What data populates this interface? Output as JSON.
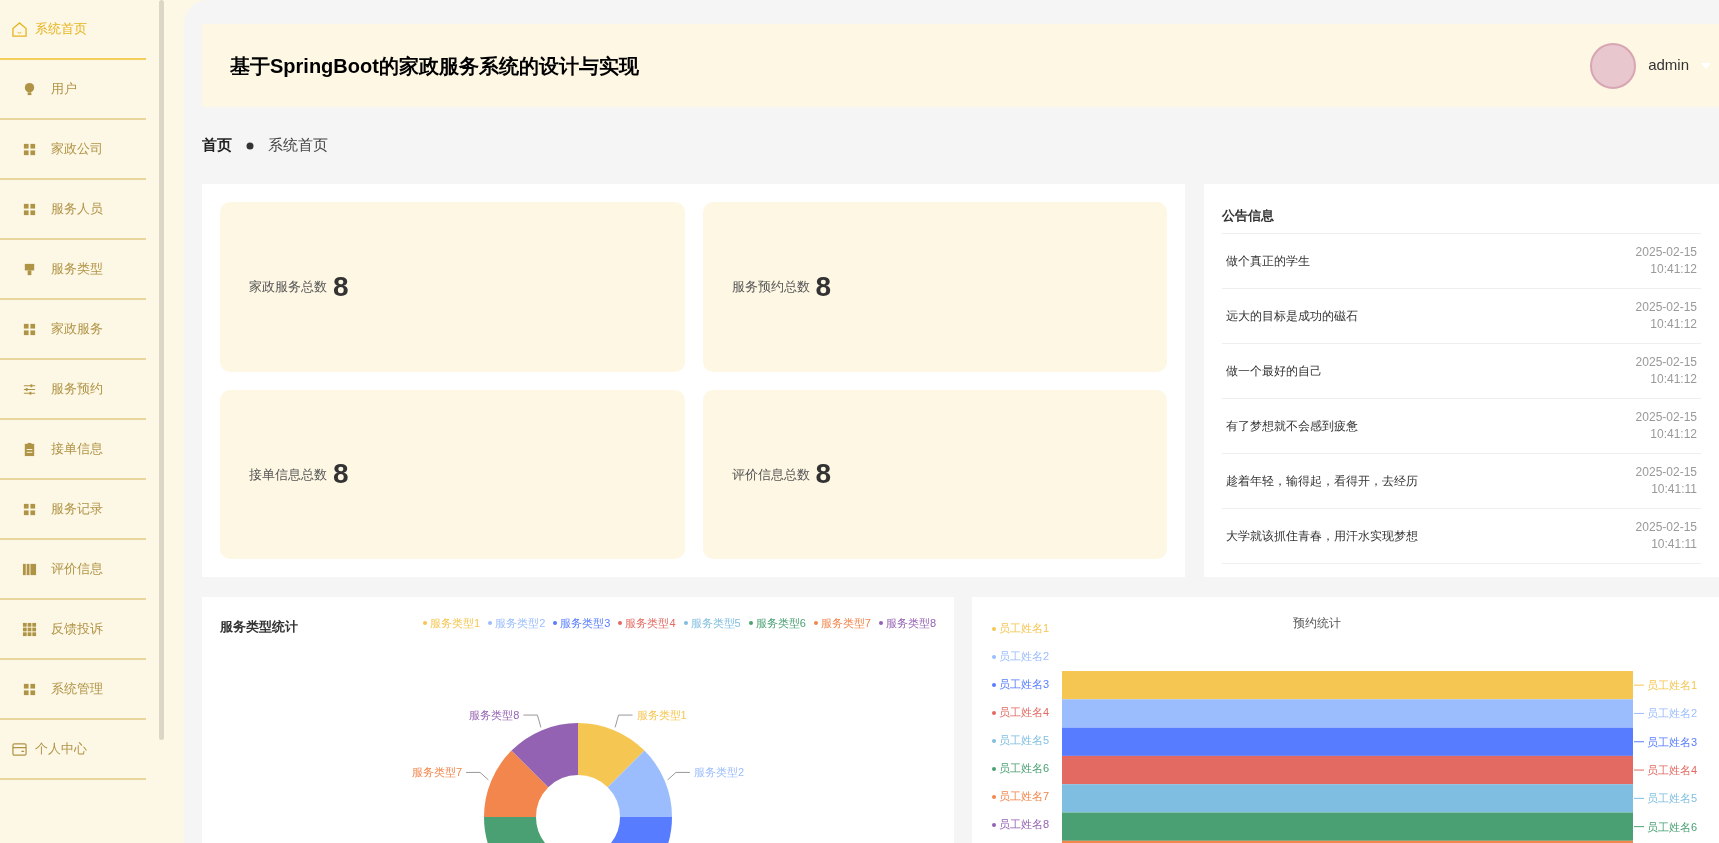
{
  "sidebar": {
    "items": [
      {
        "label": "系统首页",
        "selected": true,
        "kind": "home"
      },
      {
        "label": "用户",
        "selected": false,
        "kind": "menu"
      },
      {
        "label": "家政公司",
        "selected": false,
        "kind": "menu"
      },
      {
        "label": "服务人员",
        "selected": false,
        "kind": "menu"
      },
      {
        "label": "服务类型",
        "selected": false,
        "kind": "menu"
      },
      {
        "label": "家政服务",
        "selected": false,
        "kind": "menu"
      },
      {
        "label": "服务预约",
        "selected": false,
        "kind": "menu"
      },
      {
        "label": "接单信息",
        "selected": false,
        "kind": "menu"
      },
      {
        "label": "服务记录",
        "selected": false,
        "kind": "menu"
      },
      {
        "label": "评价信息",
        "selected": false,
        "kind": "menu"
      },
      {
        "label": "反馈投诉",
        "selected": false,
        "kind": "menu"
      },
      {
        "label": "系统管理",
        "selected": false,
        "kind": "menu"
      },
      {
        "label": "个人中心",
        "selected": false,
        "kind": "account"
      }
    ]
  },
  "header": {
    "title": "基于SpringBoot的家政服务系统的设计与实现",
    "user": "admin"
  },
  "breadcrumb": [
    "首页",
    "系统首页"
  ],
  "stats": [
    {
      "label": "家政服务总数",
      "value": "8"
    },
    {
      "label": "服务预约总数",
      "value": "8"
    },
    {
      "label": "接单信息总数",
      "value": "8"
    },
    {
      "label": "评价信息总数",
      "value": "8"
    }
  ],
  "notices": {
    "title": "公告信息",
    "items": [
      {
        "text": "做个真正的学生",
        "date": "2025-02-15",
        "time": "10:41:12"
      },
      {
        "text": "远大的目标是成功的磁石",
        "date": "2025-02-15",
        "time": "10:41:12"
      },
      {
        "text": "做一个最好的自己",
        "date": "2025-02-15",
        "time": "10:41:12"
      },
      {
        "text": "有了梦想就不会感到疲惫",
        "date": "2025-02-15",
        "time": "10:41:12"
      },
      {
        "text": "趁着年轻，输得起，看得开，去经历",
        "date": "2025-02-15",
        "time": "10:41:11"
      },
      {
        "text": "大学就该抓住青春，用汗水实现梦想",
        "date": "2025-02-15",
        "time": "10:41:11"
      }
    ]
  },
  "service_type_chart": {
    "title": "服务类型统计",
    "legend": [
      {
        "label": "服务类型1",
        "color": "#f5c652",
        "slice_label": "服务类型1"
      },
      {
        "label": "服务类型2",
        "color": "#9bbdfd",
        "slice_label": "服务类型2"
      },
      {
        "label": "服务类型3",
        "color": "#577cff"
      },
      {
        "label": "服务类型4",
        "color": "#e36a62"
      },
      {
        "label": "服务类型5",
        "color": "#7fbee0"
      },
      {
        "label": "服务类型6",
        "color": "#4aa072"
      },
      {
        "label": "服务类型7",
        "color": "#f2864c",
        "slice_label": "服务类型7"
      },
      {
        "label": "服务类型8",
        "color": "#9462b2",
        "slice_label": "服务类型8"
      }
    ]
  },
  "booking_chart": {
    "title": "预约统计",
    "legend": [
      {
        "label": "员工姓名1",
        "color": "#f5c652",
        "bar_label": "员工姓名1"
      },
      {
        "label": "员工姓名2",
        "color": "#9bbdfd",
        "bar_label": "员工姓名2"
      },
      {
        "label": "员工姓名3",
        "color": "#577cff",
        "bar_label": "员工姓名3"
      },
      {
        "label": "员工姓名4",
        "color": "#e36a62",
        "bar_label": "员工姓名4"
      },
      {
        "label": "员工姓名5",
        "color": "#7fbee0",
        "bar_label": "员工姓名5"
      },
      {
        "label": "员工姓名6",
        "color": "#4aa072",
        "bar_label": "员工姓名6"
      },
      {
        "label": "员工姓名7",
        "color": "#f2864c"
      },
      {
        "label": "员工姓名8",
        "color": "#9462b2"
      }
    ]
  }
}
